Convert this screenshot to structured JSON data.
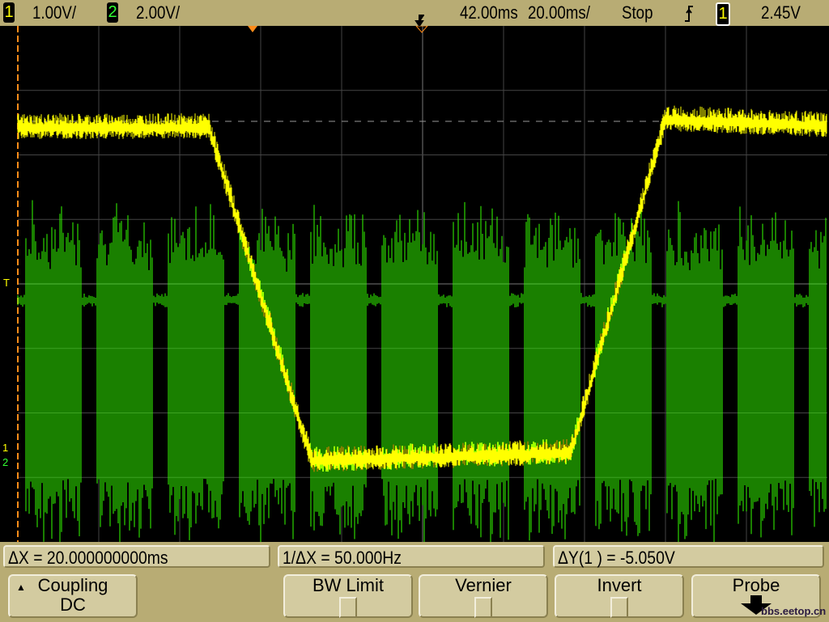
{
  "status_bar": {
    "ch1_label": "1",
    "ch1_scale": "1.00V/",
    "ch2_label": "2",
    "ch2_scale": "2.00V/",
    "delay": "42.00ms",
    "timebase": "20.00ms/",
    "run_state": "Stop",
    "trigger_slope_icon": "rising-edge-icon",
    "trigger_source": "1",
    "trigger_level": "2.45V"
  },
  "markers": {
    "trigger": "T",
    "ch1": "1",
    "ch2": "2"
  },
  "cursors": {
    "delta_x": "ΔX = 20.000000000ms",
    "inv_delta_x": "1/ΔX = 50.000Hz",
    "delta_y": "ΔY(1 ) = -5.050V"
  },
  "softkeys": {
    "coupling_label": "Coupling",
    "coupling_value": "DC",
    "bw_limit": "BW Limit",
    "vernier": "Vernier",
    "invert": "Invert",
    "probe": "Probe"
  },
  "watermark": "bbs.eetop.cn",
  "colors": {
    "ch1": "#ffff00",
    "ch2": "#33ff00",
    "marker": "#ff8c1a"
  }
}
